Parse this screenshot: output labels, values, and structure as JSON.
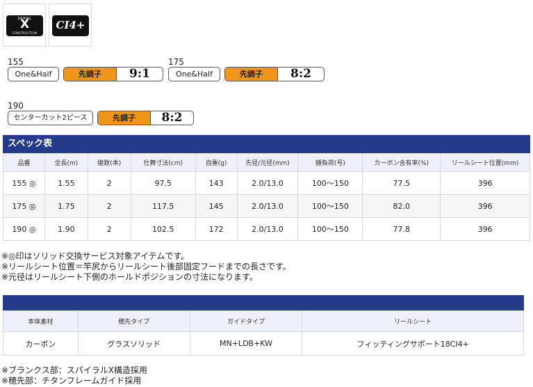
{
  "logos": {
    "spiral_x": {
      "top": "SPIRAL",
      "mark": "X",
      "bottom": "CONSTRUCTION"
    },
    "ci4": {
      "mark": "CI4+"
    }
  },
  "models": [
    {
      "code": "155",
      "type": "One&Half",
      "taper_label": "先調子",
      "taper_ratio": "9:1"
    },
    {
      "code": "175",
      "type": "One&Half",
      "taper_label": "先調子",
      "taper_ratio": "8:2"
    },
    {
      "code": "190",
      "type": "センターカット2ピース",
      "taper_label": "先調子",
      "taper_ratio": "8:2"
    }
  ],
  "spec": {
    "title": "スペック表",
    "headers": [
      "品番",
      "全長(m)",
      "継数(本)",
      "仕舞寸法(cm)",
      "自重(g)",
      "先径/元径(mm)",
      "錘負荷(号)",
      "カーボン含有率(%)",
      "リールシート位置(mm)"
    ],
    "rows": [
      [
        "155 ◎",
        "1.55",
        "2",
        "97.5",
        "143",
        "2.0/13.0",
        "100〜150",
        "77.5",
        "396"
      ],
      [
        "175 ◎",
        "1.75",
        "2",
        "117.5",
        "145",
        "2.0/13.0",
        "100〜150",
        "82.0",
        "396"
      ],
      [
        "190 ◎",
        "1.90",
        "2",
        "102.5",
        "172",
        "2.0/13.0",
        "100〜150",
        "77.8",
        "396"
      ]
    ]
  },
  "notes": [
    "※◎印はソリッド交換サービス対象アイテムです。",
    "※リールシート位置＝竿尻からリールシート後部固定フードまでの長さです。",
    "※元径はリールシート下側のホールドポジションの寸法になります。"
  ],
  "materials": {
    "headers": [
      "本体素材",
      "穂先タイプ",
      "ガイドタイプ",
      "リールシート"
    ],
    "row": [
      "カーボン",
      "グラスソリッド",
      "MN+LDB+KW",
      "フィッティングサポート18CI4+"
    ]
  },
  "footnotes": [
    "※ブランクス部：スパイラルX構造採用",
    "※穂先部：チタンフレームガイド採用"
  ],
  "colors": {
    "header_bar": "#233b8a",
    "taper_chip": "#f0961a",
    "table_header_bg": "#eef1fa"
  }
}
